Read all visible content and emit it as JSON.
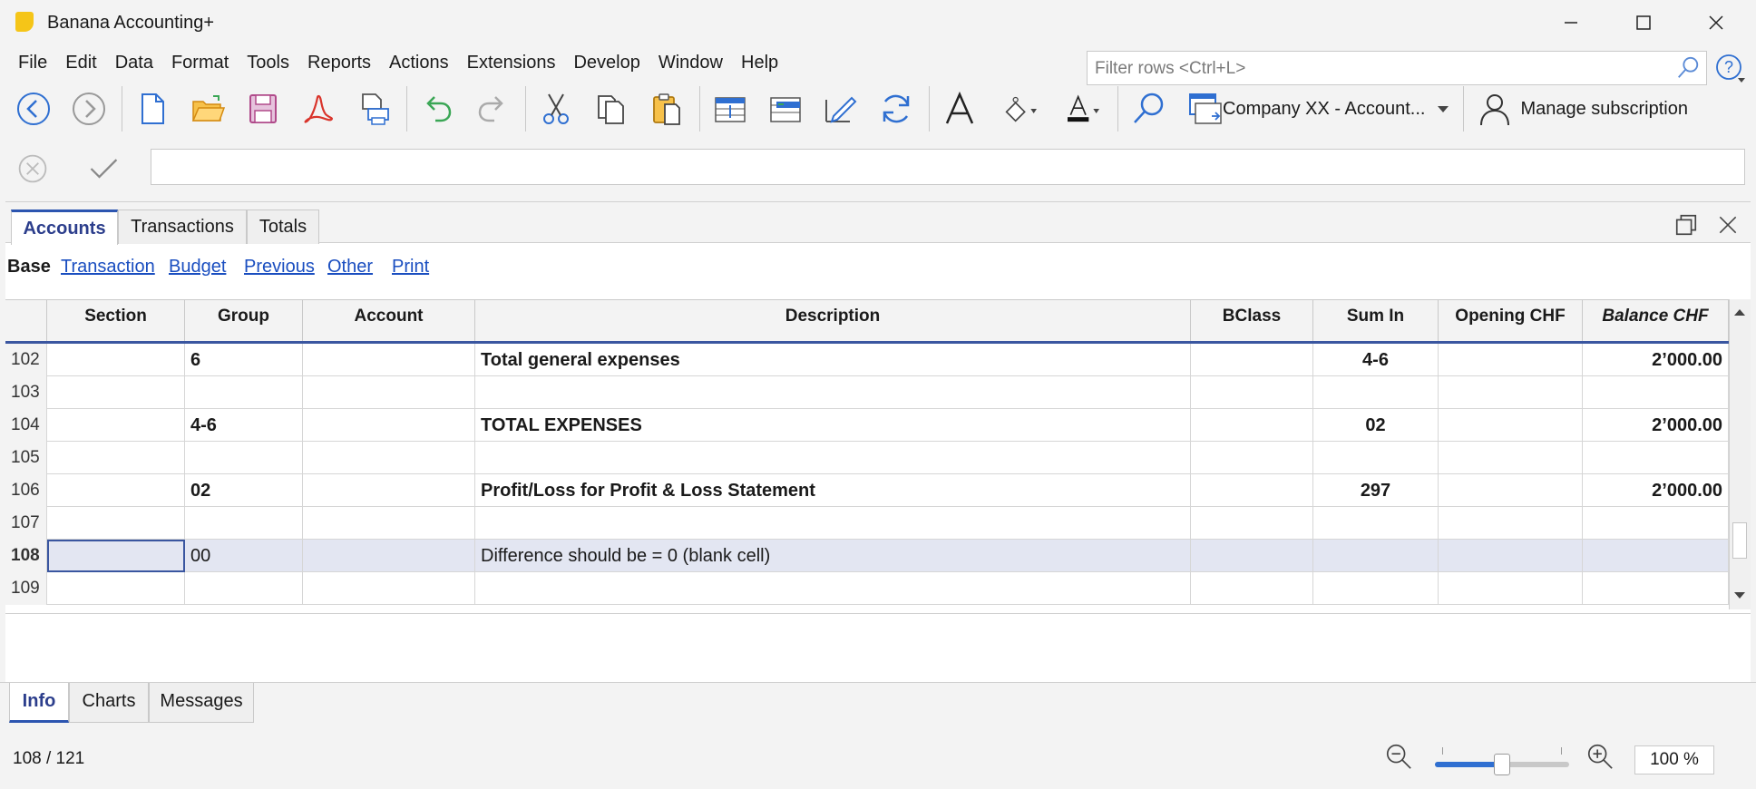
{
  "window": {
    "title": "Banana Accounting+"
  },
  "menu": [
    "File",
    "Edit",
    "Data",
    "Format",
    "Tools",
    "Reports",
    "Actions",
    "Extensions",
    "Develop",
    "Window",
    "Help"
  ],
  "toolbar": {
    "file_combo_label": "Company XX - Account...",
    "subscription_label": "Manage subscription"
  },
  "editbar": {
    "value": ""
  },
  "doc_tabs": [
    "Accounts",
    "Transactions",
    "Totals"
  ],
  "views": {
    "base": "Base",
    "links": [
      "Transaction",
      "Budget",
      "Previous",
      "Other",
      "Print"
    ]
  },
  "filter": {
    "placeholder": "Filter rows <Ctrl+L>"
  },
  "grid": {
    "columns": [
      "Section",
      "Group",
      "Account",
      "Description",
      "BClass",
      "Sum In",
      "Opening CHF",
      "Balance CHF"
    ],
    "rows": [
      {
        "num": "102",
        "section": "",
        "group": "6",
        "account": "",
        "description": "Total general expenses",
        "bclass": "",
        "sumin": "4-6",
        "opening": "",
        "balance": "2’000.00",
        "bold": true
      },
      {
        "num": "103",
        "section": "",
        "group": "",
        "account": "",
        "description": "",
        "bclass": "",
        "sumin": "",
        "opening": "",
        "balance": "",
        "bold": false
      },
      {
        "num": "104",
        "section": "",
        "group": "4-6",
        "account": "",
        "description": "TOTAL EXPENSES",
        "bclass": "",
        "sumin": "02",
        "opening": "",
        "balance": "2’000.00",
        "bold": true
      },
      {
        "num": "105",
        "section": "",
        "group": "",
        "account": "",
        "description": "",
        "bclass": "",
        "sumin": "",
        "opening": "",
        "balance": "",
        "bold": false
      },
      {
        "num": "106",
        "section": "",
        "group": "02",
        "account": "",
        "description": "Profit/Loss for Profit & Loss Statement",
        "bclass": "",
        "sumin": "297",
        "opening": "",
        "balance": "2’000.00",
        "bold": true
      },
      {
        "num": "107",
        "section": "",
        "group": "",
        "account": "",
        "description": "",
        "bclass": "",
        "sumin": "",
        "opening": "",
        "balance": "",
        "bold": false
      },
      {
        "num": "108",
        "section": "",
        "group": "00",
        "account": "",
        "description": "Difference should be = 0 (blank cell)",
        "bclass": "",
        "sumin": "",
        "opening": "",
        "balance": "",
        "bold": false,
        "selected": true
      },
      {
        "num": "109",
        "section": "",
        "group": "",
        "account": "",
        "description": "",
        "bclass": "",
        "sumin": "",
        "opening": "",
        "balance": "",
        "bold": false
      }
    ]
  },
  "info_tabs": [
    "Info",
    "Charts",
    "Messages"
  ],
  "status": {
    "position": "108 / 121",
    "zoom": "100 %",
    "zoom_level": 0.5
  },
  "colors": {
    "accent": "#2c55b0",
    "link": "#1a4ec0",
    "selected_row": "#e3e6f2"
  }
}
